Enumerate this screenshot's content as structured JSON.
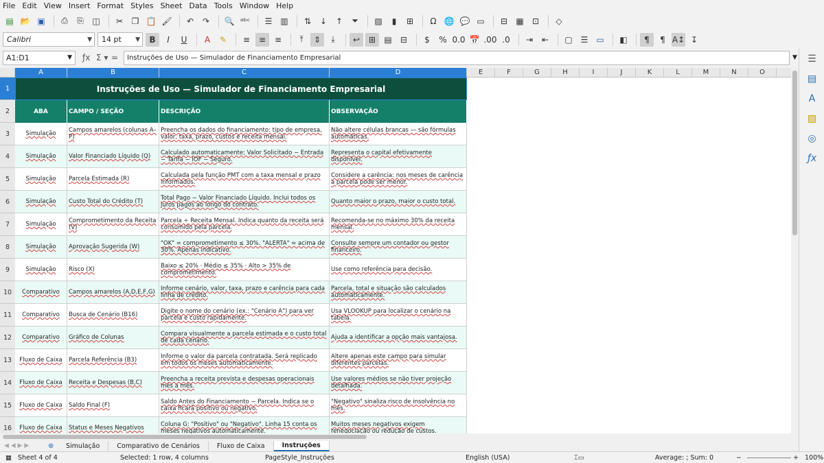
{
  "menu": [
    "File",
    "Edit",
    "View",
    "Insert",
    "Format",
    "Styles",
    "Sheet",
    "Data",
    "Tools",
    "Window",
    "Help"
  ],
  "font": {
    "name": "Calibri",
    "size": "14 pt"
  },
  "namebox": "A1:D1",
  "formula": "Instruções de Uso — Simulador de Financiamento Empresarial",
  "columns": [
    "A",
    "B",
    "C",
    "D",
    "E",
    "F",
    "G",
    "H",
    "I",
    "J",
    "K",
    "L",
    "M",
    "N",
    "O"
  ],
  "title": "Instruções de Uso — Simulador de Financiamento Empresarial",
  "headers": [
    "ABA",
    "CAMPO / SEÇÃO",
    "DESCRIÇÃO",
    "OBSERVAÇÃO"
  ],
  "rows": [
    [
      "Simulação",
      "Campos amarelos (colunas A–P)",
      "Preencha os dados do financiamento: tipo de empresa, valor, taxa, prazo, custos e receita mensal.",
      "Não altere células brancas — são fórmulas automáticas."
    ],
    [
      "Simulação",
      "Valor Financiado Líquido (Q)",
      "Calculado automaticamente: Valor Solicitado − Entrada − Tarifa − IOF − Seguro.",
      "Representa o capital efetivamente disponível."
    ],
    [
      "Simulação",
      "Parcela Estimada (R)",
      "Calculada pela função PMT com a taxa mensal e prazo informados.",
      "Considere a carência: nos meses de carência a parcela pode ser menor."
    ],
    [
      "Simulação",
      "Custo Total do Crédito (T)",
      "Total Pago − Valor Financiado Líquido. Inclui todos os juros pagos ao longo do contrato.",
      "Quanto maior o prazo, maior o custo total."
    ],
    [
      "Simulação",
      "Comprometimento da Receita (V)",
      "Parcela ÷ Receita Mensal. Indica quanto da receita será consumido pela parcela.",
      "Recomenda-se no máximo 30% da receita mensal."
    ],
    [
      "Simulação",
      "Aprovação Sugerida (W)",
      "\"OK\" = comprometimento ≤ 30%. \"ALERTA\" = acima de 30%. Apenas indicativo.",
      "Consulte sempre um contador ou gestor financeiro."
    ],
    [
      "Simulação",
      "Risco (X)",
      "Baixo ≤ 20% · Médio ≤ 35% · Alto > 35% de comprometimento.",
      "Use como referência para decisão."
    ],
    [
      "Comparativo",
      "Campos amarelos (A,D,E,F,G)",
      "Informe cenário, valor, taxa, prazo e carência para cada linha de crédito.",
      "Parcela, total e situação são calculados automaticamente."
    ],
    [
      "Comparativo",
      "Busca de Cenário (B16)",
      "Digite o nome do cenário (ex.: \"Cenário A\") para ver parcela e custo rapidamente.",
      "Usa VLOOKUP para localizar o cenário na tabela."
    ],
    [
      "Comparativo",
      "Gráfico de Colunas",
      "Compara visualmente a parcela estimada e o custo total de cada cenário.",
      "Ajuda a identificar a opção mais vantajosa."
    ],
    [
      "Fluxo de Caixa",
      "Parcela Referência (B3)",
      "Informe o valor da parcela contratada. Será replicado em todos os meses automaticamente.",
      "Altere apenas este campo para simular diferentes parcelas."
    ],
    [
      "Fluxo de Caixa",
      "Receita e Despesas (B,C)",
      "Preencha a receita prevista e despesas operacionais mês a mês.",
      "Use valores médios se não tiver projeção detalhada."
    ],
    [
      "Fluxo de Caixa",
      "Saldo Final (F)",
      "Saldo Antes do Financiamento − Parcela. Indica se o caixa ficará positivo ou negativo.",
      "\"Negativo\" sinaliza risco de insolvência no mês."
    ],
    [
      "Fluxo de Caixa",
      "Status e Meses Negativos",
      "Coluna G: \"Positivo\" ou \"Negativo\". Linha 15 conta os meses negativos automaticamente.",
      "Muitos meses negativos exigem renegociação ou redução de custos."
    ]
  ],
  "tabs": [
    "Simulação",
    "Comparativo de Cenários",
    "Fluxo de Caixa",
    "Instruções"
  ],
  "active_tab": "Instruções",
  "status": {
    "sheet": "Sheet 4 of 4",
    "selection": "Selected: 1 row, 4 columns",
    "pagestyle": "PageStyle_Instruções",
    "language": "English (USA)",
    "summary": "Average: ; Sum: 0",
    "zoom": "100%"
  },
  "colors": {
    "title_bg": "#0d4f3c",
    "header_bg": "#15806a",
    "alt_row": "#eafaf6",
    "selection": "#2b7fd4"
  }
}
